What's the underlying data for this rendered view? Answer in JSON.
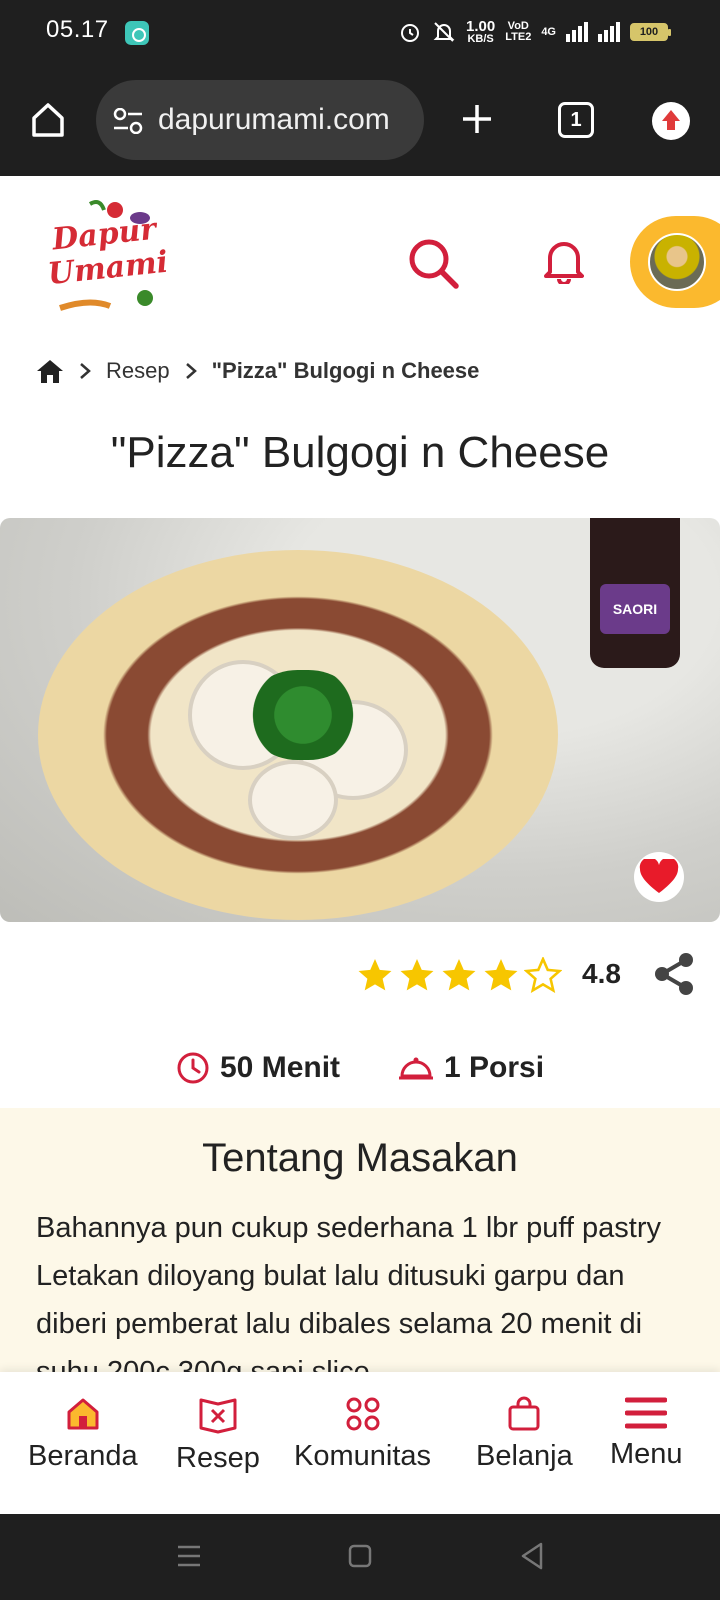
{
  "status_bar": {
    "time": "05.17",
    "net_speed_top": "1.00",
    "net_speed_bottom": "KB/S",
    "volte_top": "VoD",
    "volte_bottom": "LTE2",
    "network": "4G",
    "battery": "100"
  },
  "browser": {
    "url": "dapurumami.com",
    "tab_count": "1"
  },
  "header": {
    "logo_line1": "Dapur",
    "logo_line2": "Umami"
  },
  "breadcrumb": {
    "items": [
      "Resep",
      "\"Pizza\" Bulgogi n Cheese"
    ]
  },
  "recipe": {
    "title": "\"Pizza\" Bulgogi n Cheese",
    "rating": 4.8,
    "rating_text": "4.8",
    "rating_max": 5,
    "duration": "50 Menit",
    "portion": "1 Porsi",
    "bottle_label": "SAORI"
  },
  "about": {
    "title": "Tentang Masakan",
    "text": "Bahannya pun cukup sederhana 1 lbr puff pastry Letakan diloyang bulat lalu ditusuki garpu dan diberi pemberat lalu dibales selama 20 menit di suhu 200c 300g sapi slice"
  },
  "bottom_nav": {
    "items": [
      "Beranda",
      "Resep",
      "Komunitas",
      "Belanja",
      "Menu"
    ]
  },
  "colors": {
    "brand_red": "#d21f3c",
    "accent_yellow": "#fbb92e",
    "star_yellow": "#f7c600",
    "about_bg": "#fdf8e8",
    "dark_bar": "#1f1f1f"
  }
}
